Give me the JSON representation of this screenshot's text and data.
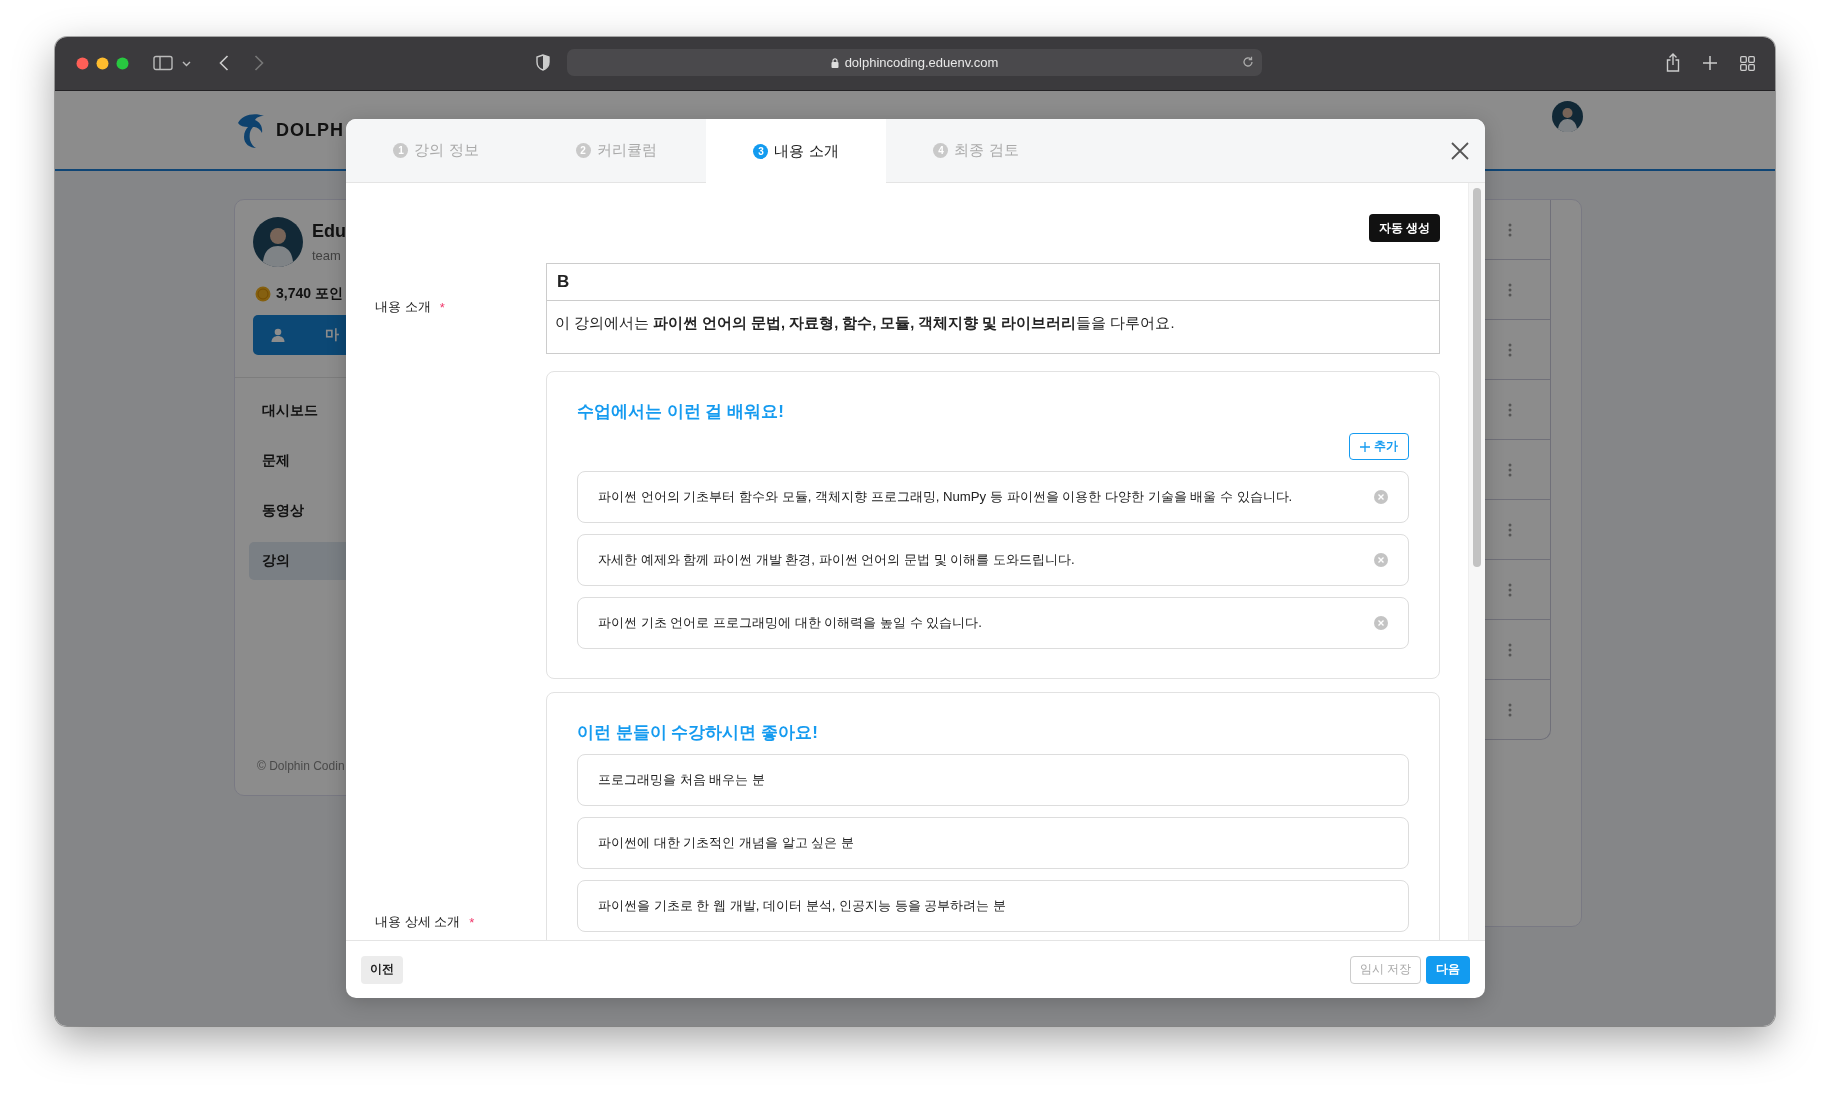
{
  "browser": {
    "url": "dolphincoding.eduenv.com"
  },
  "page": {
    "logo": "DOLPH",
    "profile": {
      "name": "Edu",
      "email": "team",
      "points": "3,740 포인",
      "button": "마"
    },
    "menu": [
      {
        "label": "대시보드",
        "selected": false
      },
      {
        "label": "문제",
        "selected": false
      },
      {
        "label": "동영상",
        "selected": false
      },
      {
        "label": "강의",
        "selected": true
      }
    ],
    "footer": "© Dolphin Codin"
  },
  "modal": {
    "tabs": [
      {
        "number": "1",
        "label": "강의 정보",
        "selected": false
      },
      {
        "number": "2",
        "label": "커리큘럼",
        "selected": false
      },
      {
        "number": "3",
        "label": "내용 소개",
        "selected": true
      },
      {
        "number": "4",
        "label": "최종 검토",
        "selected": false
      }
    ],
    "auto_button": "자동 생성",
    "fields": [
      {
        "label": "내용 소개",
        "required_mark": "*"
      },
      {
        "label": "내용 상세 소개",
        "required_mark": "*"
      }
    ],
    "editor": {
      "bold_button": "B",
      "content": "이 강의에서는 **파이썬 언어의 문법, 자료형, 함수, 모듈, 객체지향 및 라이브러리**들을 다루어요."
    },
    "sections": [
      {
        "title": "수업에서는 이런 걸 배워요!",
        "add_button": "추가",
        "items": [
          {
            "text": "파이썬 언어의 기초부터 함수와 모듈, 객체지향 프로그래밍, NumPy 등 파이썬을 이용한 다양한 기술을 배울 수 있습니다.",
            "removable": true
          },
          {
            "text": "자세한 예제와 함께 파이썬 개발 환경, 파이썬 언어의 문법 및 이해를 도와드립니다.",
            "removable": true
          },
          {
            "text": "파이썬 기초 언어로 프로그래밍에 대한 이해력을 높일 수 있습니다.",
            "removable": true
          }
        ]
      },
      {
        "title": "이런 분들이 수강하시면 좋아요!",
        "items": [
          {
            "text": "프로그래밍을 처음 배우는 분",
            "removable": false
          },
          {
            "text": "파이썬에 대한 기초적인 개념을 알고 싶은 분",
            "removable": false
          },
          {
            "text": "파이썬을 기초로 한 웹 개발, 데이터 분석, 인공지능 등을 공부하려는 분",
            "removable": false
          }
        ]
      }
    ],
    "footer": {
      "prev": "이전",
      "save": {
        "label": "임시 저장",
        "disabled": true
      },
      "next": "다음"
    }
  }
}
